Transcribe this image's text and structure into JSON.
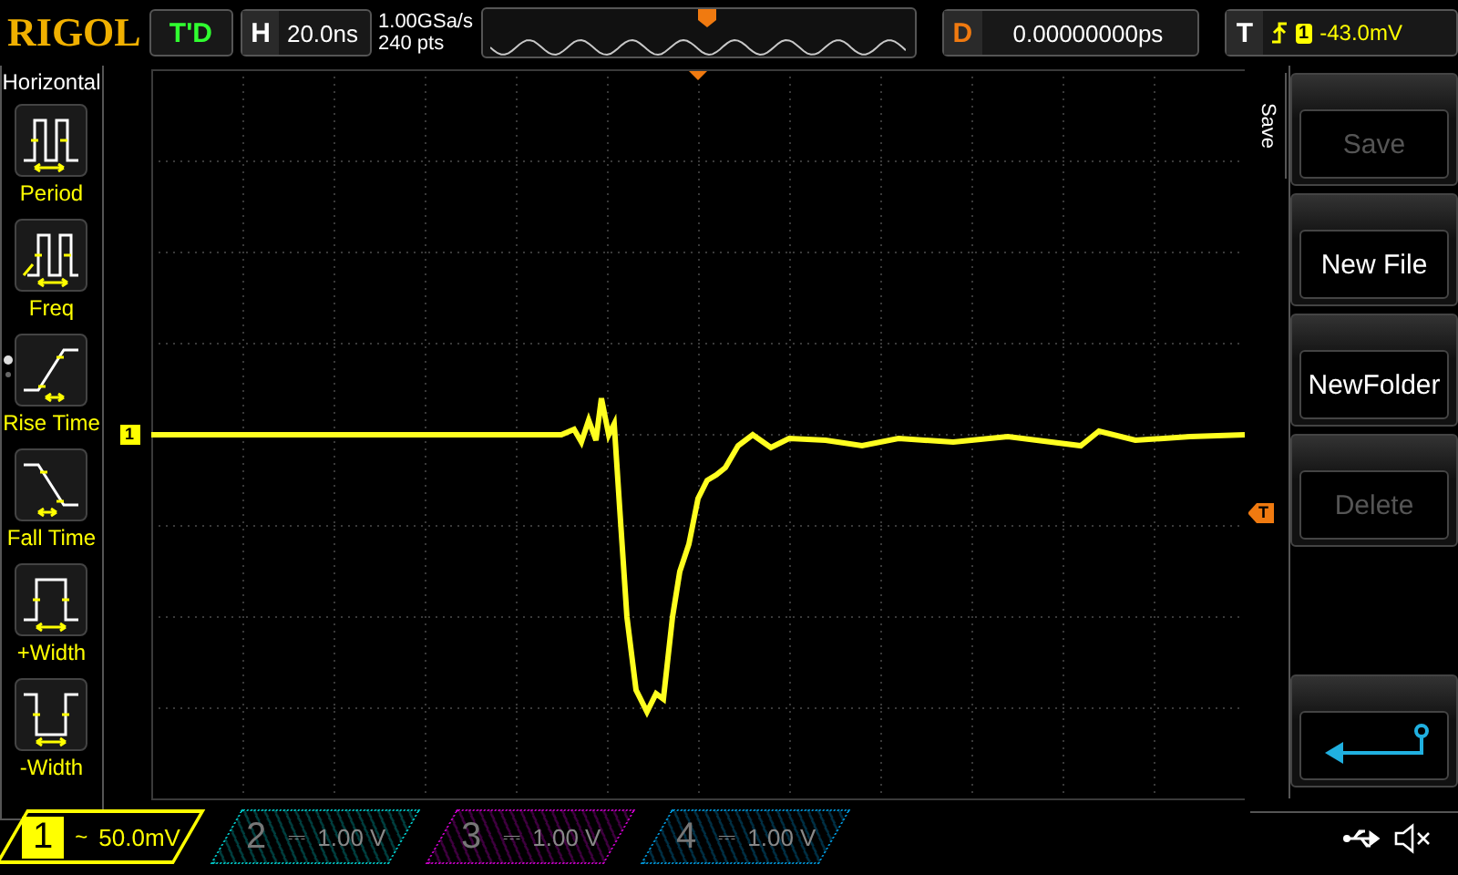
{
  "logo": "RIGOL",
  "run_status": "T'D",
  "timebase": {
    "label": "H",
    "value": "20.0ns"
  },
  "sample": {
    "rate": "1.00GSa/s",
    "points": "240 pts"
  },
  "delay": {
    "label": "D",
    "value": "0.00000000ps"
  },
  "trigger": {
    "label": "T",
    "source": "1",
    "level": "-43.0mV"
  },
  "measure_panel": {
    "title": "Horizontal",
    "pages": [
      {
        "selected": true
      },
      {
        "selected": false
      }
    ],
    "items": [
      {
        "kind": "period",
        "label": "Period"
      },
      {
        "kind": "freq",
        "label": "Freq"
      },
      {
        "kind": "rise",
        "label": "Rise Time"
      },
      {
        "kind": "fall",
        "label": "Fall Time"
      },
      {
        "kind": "pwidth",
        "label": "+Width"
      },
      {
        "kind": "nwidth",
        "label": "-Width"
      }
    ]
  },
  "scope": {
    "channel_marker": "1",
    "trigger_marker": "T"
  },
  "menu": {
    "title": "Save",
    "buttons": [
      {
        "kind": "text",
        "label": "Save",
        "disabled": true
      },
      {
        "kind": "text",
        "label": "New File",
        "disabled": false
      },
      {
        "kind": "text",
        "label": "NewFolder",
        "disabled": false
      },
      {
        "kind": "text",
        "label": "Delete",
        "disabled": true
      },
      {
        "kind": "back"
      }
    ]
  },
  "channels": [
    {
      "number": "1",
      "coupling": "~",
      "scale": "50.0mV",
      "selected": true,
      "color": "#ffff00"
    },
    {
      "number": "2",
      "coupling": "⎓",
      "scale": "1.00 V",
      "selected": false,
      "color": "#00c0c0"
    },
    {
      "number": "3",
      "coupling": "⎓",
      "scale": "1.00 V",
      "selected": false,
      "color": "#c000c0"
    },
    {
      "number": "4",
      "coupling": "⎓",
      "scale": "1.00 V",
      "selected": false,
      "color": "#0090d0"
    }
  ]
}
